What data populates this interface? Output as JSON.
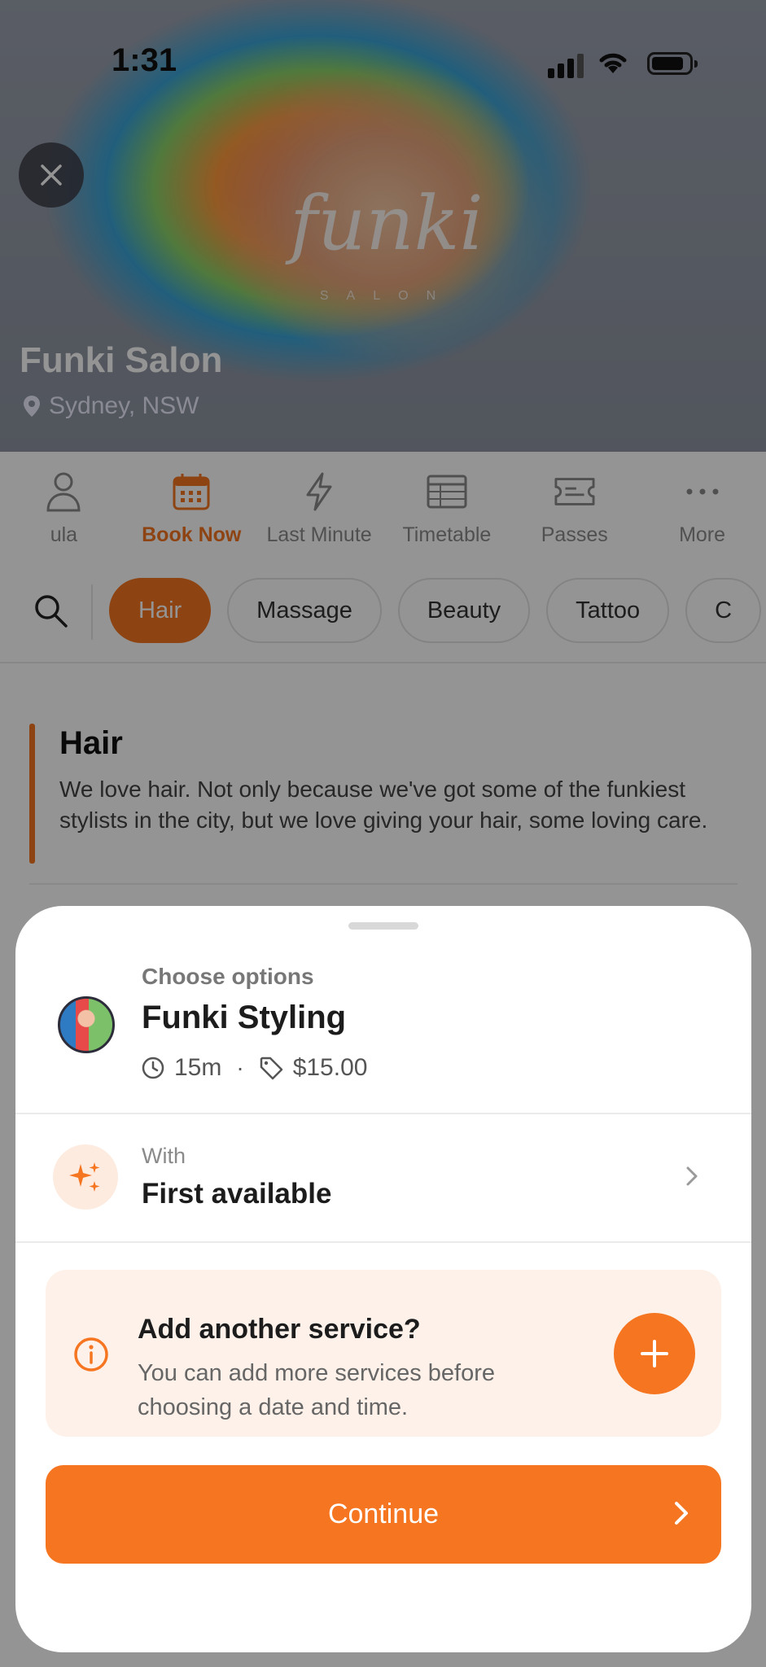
{
  "status_bar": {
    "time": "1:31"
  },
  "hero": {
    "logo_text": "funki",
    "logo_sub": "SALON",
    "salon_name": "Funki Salon",
    "location": "Sydney, NSW"
  },
  "nav": {
    "items": [
      {
        "label": "ula",
        "icon": "person-icon"
      },
      {
        "label": "Book Now",
        "icon": "calendar-icon",
        "active": true
      },
      {
        "label": "Last Minute",
        "icon": "lightning-icon"
      },
      {
        "label": "Timetable",
        "icon": "table-icon"
      },
      {
        "label": "Passes",
        "icon": "ticket-icon"
      },
      {
        "label": "More",
        "icon": "more-icon"
      }
    ]
  },
  "categories": {
    "items": [
      "Hair",
      "Massage",
      "Beauty",
      "Tattoo",
      "C"
    ],
    "active": "Hair"
  },
  "section": {
    "title": "Hair",
    "description": "We love hair. Not only because we've got some of the funkiest stylists in the city, but we love giving your hair, some loving care."
  },
  "sheet": {
    "kicker": "Choose options",
    "service_name": "Funki Styling",
    "duration": "15m",
    "separator": "·",
    "price": "$15.00",
    "with_label": "With",
    "with_value": "First available",
    "add_title": "Add another service?",
    "add_desc": "You can add more services before choosing a date and time.",
    "continue_label": "Continue"
  },
  "colors": {
    "accent": "#f57520",
    "accent_light": "#fdf1e9"
  }
}
